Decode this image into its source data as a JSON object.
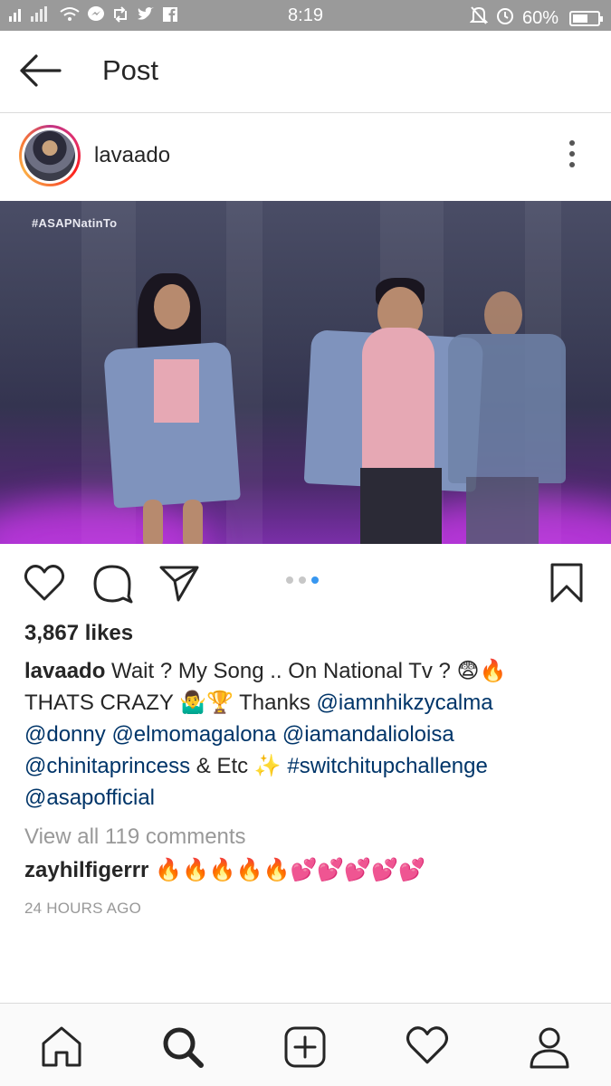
{
  "status_bar": {
    "time": "8:19",
    "battery_percent": "60%",
    "battery_level": 0.6
  },
  "header": {
    "title": "Post"
  },
  "post": {
    "username": "lavaado",
    "media_hashtag": "#ASAPNatinTo",
    "carousel": {
      "count": 3,
      "active_index": 2
    },
    "likes": "3,867 likes",
    "caption": {
      "author": "lavaado",
      "line1_text": " Wait ? My Song .. On National Tv ? 😨🔥",
      "line2_text": "THATS CRAZY 🤷‍♂🏆 Thanks ",
      "mention_iamnhikzycalma": "@iamnhikzycalma",
      "mention_donny": "@donny",
      "mention_elmomagalona": "@elmomagalona",
      "mention_iamandalioloisa": "@iamandalioloisa",
      "mention_chinitaprincess": "@chinitaprincess",
      "etc_text": " & Etc ✨ ",
      "hashtag_switchitup": "#switchitupchallenge",
      "mention_asapofficial": "@asapofficial"
    },
    "view_comments": "View all 119 comments",
    "comment": {
      "author": "zayhilfigerrr",
      "text": " 🔥🔥🔥🔥🔥💕💕💕💕💕"
    },
    "time_ago": "24 HOURS AGO"
  },
  "colors": {
    "accent_blue": "#3897f0",
    "link_blue": "#003569",
    "status_bar_gray": "#9a9a9a"
  },
  "icons": {
    "back": "arrow-left-icon",
    "more": "vertical-dots-icon",
    "like": "heart-icon",
    "comment": "speech-bubble-icon",
    "share": "paper-plane-icon",
    "save": "bookmark-icon",
    "nav_home": "home-icon",
    "nav_search": "search-icon",
    "nav_add": "add-post-icon",
    "nav_activity": "heart-icon",
    "nav_profile": "profile-icon"
  }
}
